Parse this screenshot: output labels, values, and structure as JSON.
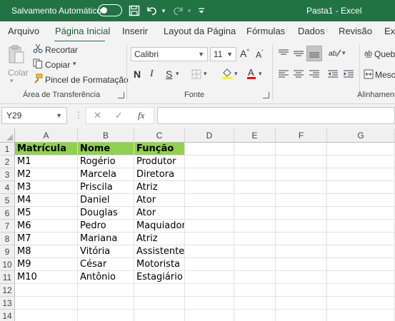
{
  "titlebar": {
    "autosave_label": "Salvamento Automático",
    "title": "Pasta1  -  Excel"
  },
  "tabs": [
    "Arquivo",
    "Página Inicial",
    "Inserir",
    "Layout da Página",
    "Fórmulas",
    "Dados",
    "Revisão",
    "Exi"
  ],
  "ribbon": {
    "clipboard": {
      "paste_label": "Colar",
      "cut_label": "Recortar",
      "copy_label": "Copiar",
      "format_painter_label": "Pincel de Formatação",
      "group_label": "Área de Transferência"
    },
    "font": {
      "font_name": "Calibri",
      "font_size": "11",
      "bold": "N",
      "italic": "I",
      "underline": "S",
      "group_label": "Fonte"
    },
    "alignment": {
      "wrap_label": "Quebr",
      "merge_label": "Mescl",
      "group_label": "Alinhament"
    }
  },
  "formula_bar": {
    "name_box": "Y29",
    "fx_label": "fx",
    "formula": ""
  },
  "sheet": {
    "columns": [
      "A",
      "B",
      "C",
      "D",
      "E",
      "F",
      "G"
    ],
    "row_numbers": [
      "1",
      "2",
      "3",
      "4",
      "5",
      "6",
      "7",
      "8",
      "9",
      "10",
      "11",
      "12",
      "13",
      "14"
    ],
    "header": [
      "Matrícula",
      "Nome",
      "Função"
    ],
    "rows": [
      [
        "M1",
        "Rogério",
        "Produtor"
      ],
      [
        "M2",
        "Marcela",
        "Diretora"
      ],
      [
        "M3",
        "Priscila",
        "Atriz"
      ],
      [
        "M4",
        "Daniel",
        "Ator"
      ],
      [
        "M5",
        "Douglas",
        "Ator"
      ],
      [
        "M6",
        "Pedro",
        "Maquiador"
      ],
      [
        "M7",
        "Mariana",
        "Atriz"
      ],
      [
        "M8",
        "Vitória",
        "Assistente"
      ],
      [
        "M9",
        "César",
        "Motorista"
      ],
      [
        "M10",
        "Antônio",
        "Estagiário"
      ]
    ],
    "header_fill": "#92d050"
  },
  "colors": {
    "excel_green": "#217346",
    "ribbon_bg": "#f3f3f3"
  }
}
